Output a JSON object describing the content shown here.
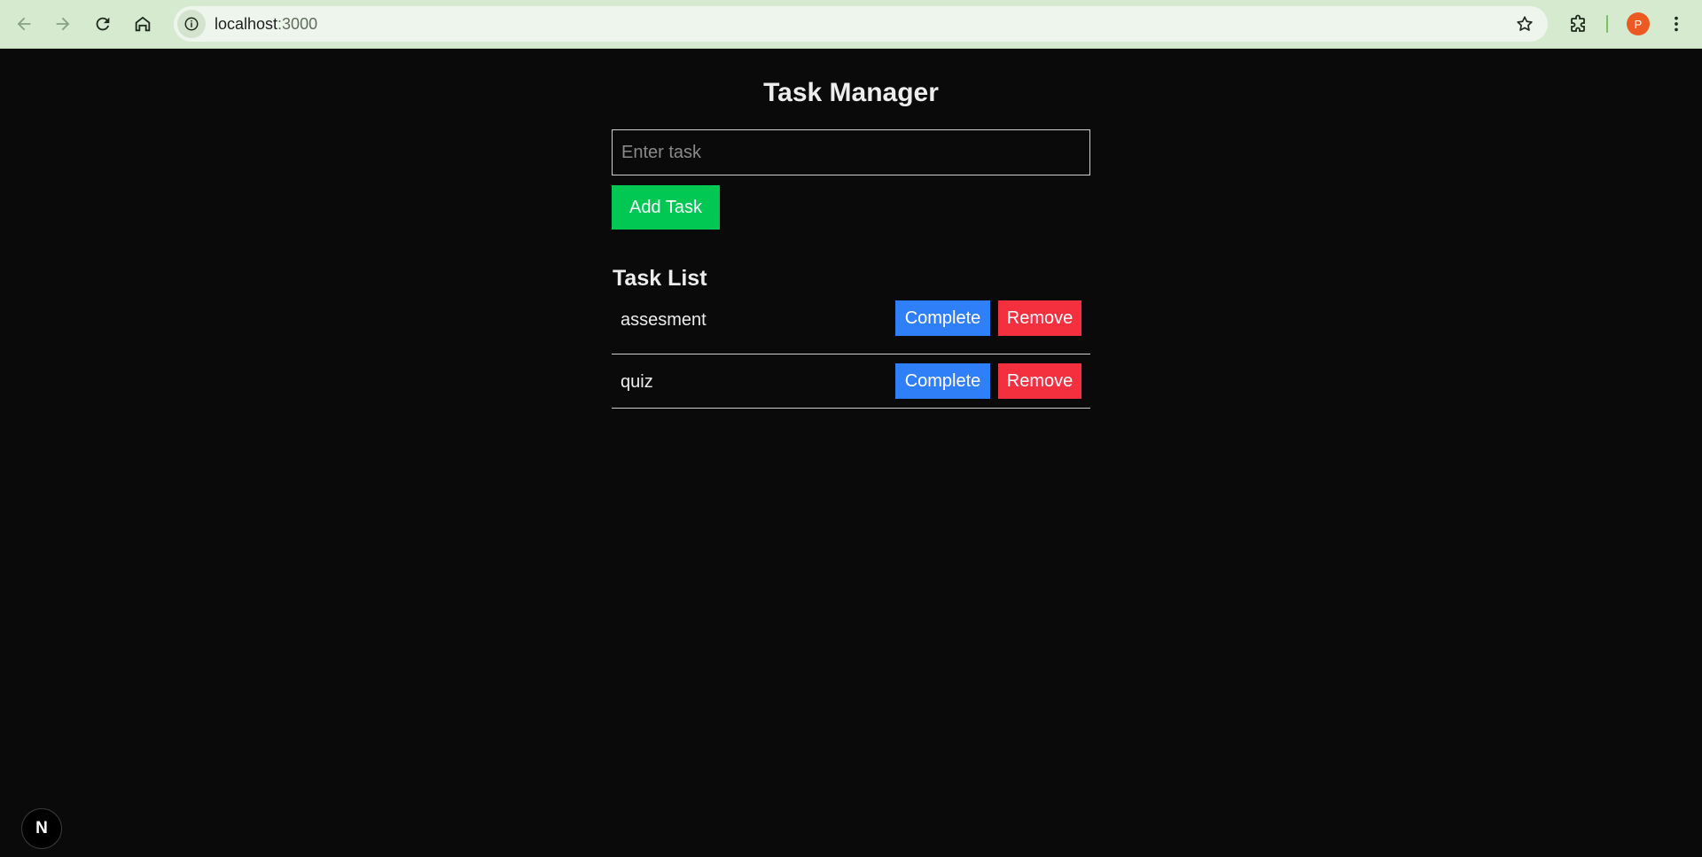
{
  "browser": {
    "url_host": "localhost",
    "url_port": ":3000",
    "profile_initial": "P",
    "icons": {
      "back": "arrow-left-icon",
      "forward": "arrow-right-icon",
      "reload": "reload-icon",
      "home": "home-icon",
      "site_info": "info-icon",
      "bookmark": "star-icon",
      "extensions": "puzzle-icon",
      "menu": "kebab-menu-icon"
    },
    "colors": {
      "toolbar": "#d6ead0",
      "omnibox": "#eef5ec",
      "avatar": "#ec5a21"
    }
  },
  "app": {
    "title": "Task Manager",
    "input": {
      "placeholder": "Enter task",
      "value": ""
    },
    "add_button_label": "Add Task",
    "list_title": "Task List",
    "tasks": [
      {
        "name": "assesment",
        "complete_label": "Complete",
        "remove_label": "Remove"
      },
      {
        "name": "quiz",
        "complete_label": "Complete",
        "remove_label": "Remove"
      }
    ],
    "colors": {
      "background": "#0a0a0a",
      "add": "#00c853",
      "complete": "#2f7ff8",
      "remove": "#f4303f"
    }
  },
  "dev_badge": {
    "label": "N",
    "icon": "nextjs-icon"
  }
}
